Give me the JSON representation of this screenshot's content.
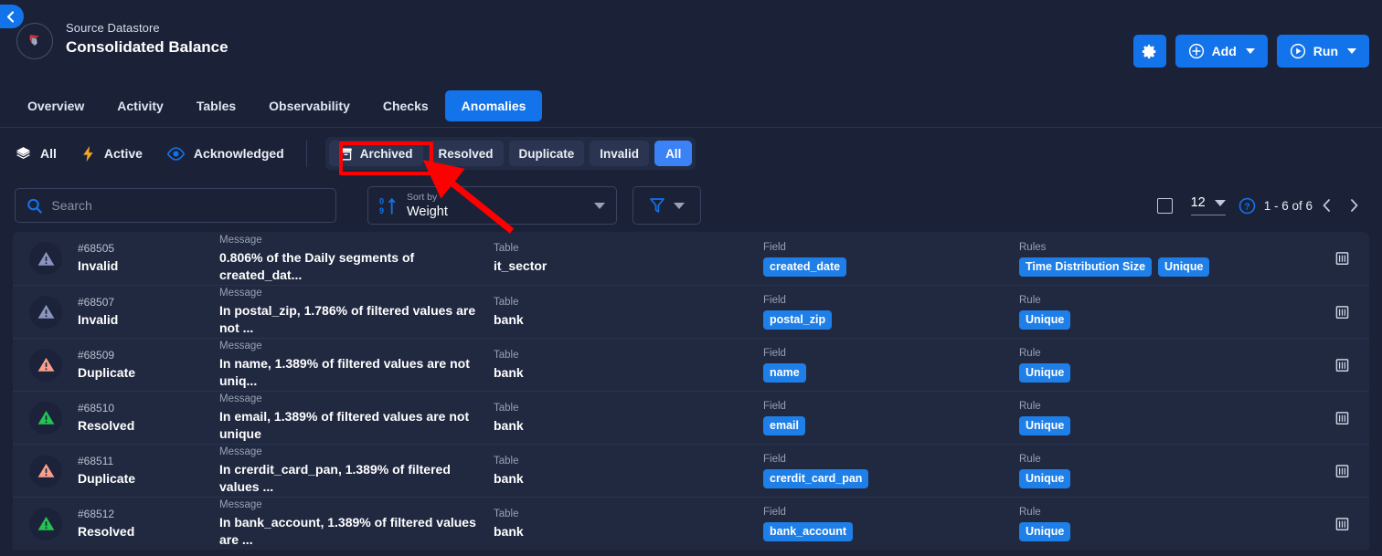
{
  "nav": {
    "back_label": "back"
  },
  "header": {
    "kicker": "Source Datastore",
    "title": "Consolidated Balance",
    "logo_name": "datastore-logo",
    "actions": {
      "settings_label": "",
      "add_label": "Add",
      "run_label": "Run"
    }
  },
  "tabs": [
    {
      "label": "Overview",
      "active": false
    },
    {
      "label": "Activity",
      "active": false
    },
    {
      "label": "Tables",
      "active": false
    },
    {
      "label": "Observability",
      "active": false
    },
    {
      "label": "Checks",
      "active": false
    },
    {
      "label": "Anomalies",
      "active": true
    }
  ],
  "filters": {
    "views": [
      {
        "label": "All",
        "icon": "layers-icon"
      },
      {
        "label": "Active",
        "icon": "bolt-icon"
      },
      {
        "label": "Acknowledged",
        "icon": "eye-icon"
      }
    ],
    "chips": [
      {
        "label": "Archived",
        "icon": "archive-icon",
        "selected": false
      },
      {
        "label": "Resolved",
        "icon": "",
        "selected": false
      },
      {
        "label": "Duplicate",
        "icon": "",
        "selected": false
      },
      {
        "label": "Invalid",
        "icon": "",
        "selected": false
      },
      {
        "label": "All",
        "icon": "",
        "selected": true
      }
    ]
  },
  "toolbar": {
    "search_placeholder": "Search",
    "search_value": "",
    "sort_kicker": "Sort by",
    "sort_value": "Weight",
    "filter_icon": "funnel-icon",
    "page_size": "12",
    "page_range": "1 - 6 of 6",
    "prev_label": "previous page",
    "next_label": "next page"
  },
  "columns": {
    "message": "Message",
    "table": "Table",
    "field": "Field",
    "rules_plural": "Rules",
    "rule_single": "Rule"
  },
  "rows": [
    {
      "id": "#68505",
      "status": "Invalid",
      "status_color": "#8a95bd",
      "message": "0.806% of the Daily segments of created_dat...",
      "table": "it_sector",
      "field": "created_date",
      "rules_label": "Rules",
      "rules": [
        "Time Distribution Size",
        "Unique"
      ]
    },
    {
      "id": "#68507",
      "status": "Invalid",
      "status_color": "#8a95bd",
      "message": "In postal_zip, 1.786% of filtered values are not ...",
      "table": "bank",
      "field": "postal_zip",
      "rules_label": "Rule",
      "rules": [
        "Unique"
      ]
    },
    {
      "id": "#68509",
      "status": "Duplicate",
      "status_color": "#f9a08c",
      "message": "In name, 1.389% of filtered values are not uniq...",
      "table": "bank",
      "field": "name",
      "rules_label": "Rule",
      "rules": [
        "Unique"
      ]
    },
    {
      "id": "#68510",
      "status": "Resolved",
      "status_color": "#25c254",
      "message": "In email, 1.389% of filtered values are not unique",
      "table": "bank",
      "field": "email",
      "rules_label": "Rule",
      "rules": [
        "Unique"
      ]
    },
    {
      "id": "#68511",
      "status": "Duplicate",
      "status_color": "#f9a08c",
      "message": "In crerdit_card_pan, 1.389% of filtered values ...",
      "table": "bank",
      "field": "crerdit_card_pan",
      "rules_label": "Rule",
      "rules": [
        "Unique"
      ]
    },
    {
      "id": "#68512",
      "status": "Resolved",
      "status_color": "#25c254",
      "message": "In bank_account, 1.389% of filtered values are ...",
      "table": "bank",
      "field": "bank_account",
      "rules_label": "Rule",
      "rules": [
        "Unique"
      ]
    }
  ],
  "annotation": {
    "highlight_target": "Archived",
    "color": "#ff0000"
  },
  "colors": {
    "accent": "#1273ea",
    "chip_selected": "#3b82f6",
    "tag": "#1f7fe8",
    "page_bg": "#1b2238",
    "card_bg": "#212941"
  }
}
